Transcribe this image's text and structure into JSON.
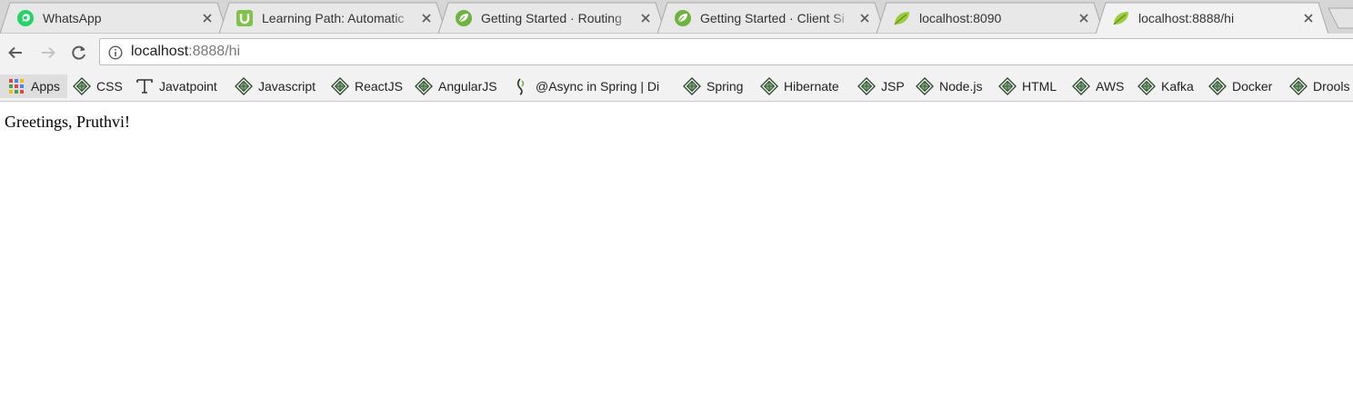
{
  "tabs": [
    {
      "title": "WhatsApp",
      "icon": "whatsapp-icon",
      "active": false
    },
    {
      "title": "Learning Path: Automatic",
      "icon": "udemy-icon",
      "active": false
    },
    {
      "title": "Getting Started · Routing",
      "icon": "spring-icon",
      "active": false
    },
    {
      "title": "Getting Started · Client Si",
      "icon": "spring-icon",
      "active": false
    },
    {
      "title": "localhost:8090",
      "icon": "spring-leaf-icon",
      "active": false
    },
    {
      "title": "localhost:8888/hi",
      "icon": "spring-leaf-icon",
      "active": true
    }
  ],
  "address_bar": {
    "host": "localhost",
    "path": ":8888/hi"
  },
  "bookmarks": [
    {
      "label": "Apps",
      "icon": "apps-grid-icon"
    },
    {
      "label": "CSS",
      "icon": "bookmark-globe-icon"
    },
    {
      "label": "Javatpoint",
      "icon": "javatpoint-icon"
    },
    {
      "label": "Javascript",
      "icon": "bookmark-globe-icon"
    },
    {
      "label": "ReactJS",
      "icon": "bookmark-globe-icon"
    },
    {
      "label": "AngularJS",
      "icon": "bookmark-globe-icon"
    },
    {
      "label": "@Async in Spring | Di",
      "icon": "baeldung-icon"
    },
    {
      "label": "Spring",
      "icon": "bookmark-globe-icon"
    },
    {
      "label": "Hibernate",
      "icon": "bookmark-globe-icon"
    },
    {
      "label": "JSP",
      "icon": "bookmark-globe-icon"
    },
    {
      "label": "Node.js",
      "icon": "bookmark-globe-icon"
    },
    {
      "label": "HTML",
      "icon": "bookmark-globe-icon"
    },
    {
      "label": "AWS",
      "icon": "bookmark-globe-icon"
    },
    {
      "label": "Kafka",
      "icon": "bookmark-globe-icon"
    },
    {
      "label": "Docker",
      "icon": "bookmark-globe-icon"
    },
    {
      "label": "Drools",
      "icon": "bookmark-globe-icon"
    }
  ],
  "page": {
    "greeting": "Greetings, Pruthvi!"
  },
  "colors": {
    "tabstrip": "#d6d6d6",
    "toolbar": "#f2f2f2",
    "whatsapp": "#25d366",
    "udemy": "#7fc24a",
    "spring": "#6db33f"
  }
}
